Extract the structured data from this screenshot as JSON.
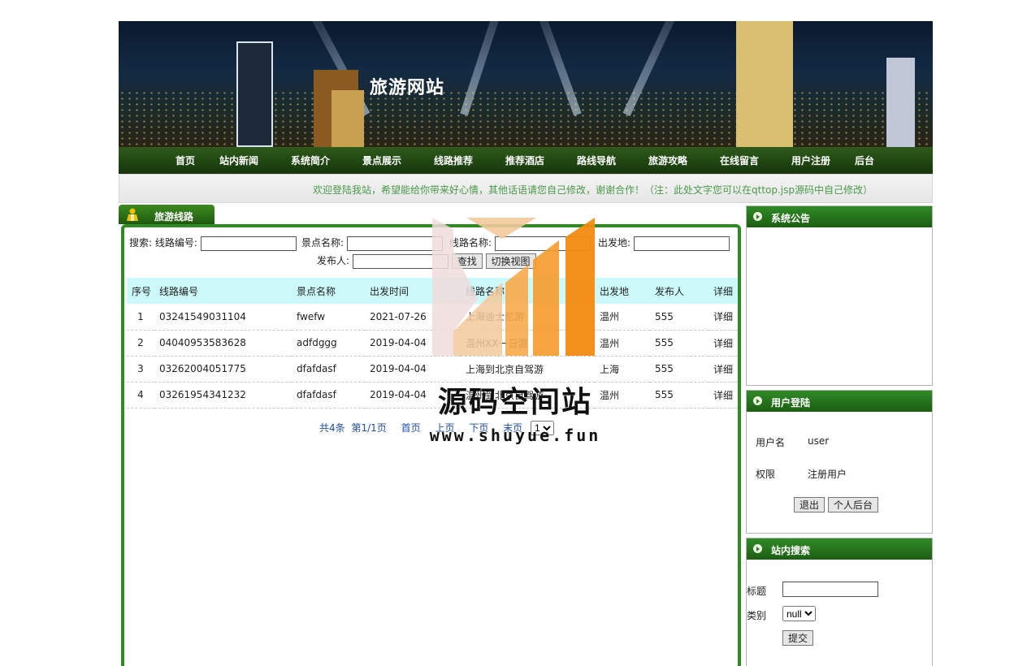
{
  "banner": {
    "title": "旅游网站"
  },
  "nav": {
    "items": [
      "首页",
      "站内新闻",
      "系统简介",
      "景点展示",
      "线路推荐",
      "推荐酒店",
      "路线导航",
      "旅游攻略",
      "在线留言",
      "用户注册",
      "后台"
    ]
  },
  "marquee": {
    "text": "欢迎登陆我站，希望能给你带来好心情，其他话语请您自己修改，谢谢合作！（注：此处文字您可以在qttop.jsp源码中自己修改）"
  },
  "left_panel": {
    "tab_title": "旅游线路",
    "search": {
      "prefix": "搜索:",
      "route_code_label": "线路编号:",
      "spot_name_label": "景点名称:",
      "route_name_label": "线路名称:",
      "departure_label": "出发地:",
      "publisher_label": "发布人:",
      "route_code_value": "",
      "spot_name_value": "",
      "route_name_value": "",
      "departure_value": "",
      "publisher_value": "",
      "search_button": "查找",
      "switch_button": "切换视图"
    },
    "table": {
      "columns": [
        "序号",
        "线路编号",
        "景点名称",
        "出发时间",
        "线路名称",
        "出发地",
        "发布人",
        "详细"
      ],
      "rows": [
        {
          "num": "1",
          "code": "03241549031104",
          "spot": "fwefw",
          "time": "2021-07-26",
          "name": "上海迪士尼游",
          "from": "温州",
          "publisher": "555",
          "detail": "详细"
        },
        {
          "num": "2",
          "code": "04040953583628",
          "spot": "adfdggg",
          "time": "2019-04-04",
          "name": "温州XX一日游",
          "from": "温州",
          "publisher": "555",
          "detail": "详细"
        },
        {
          "num": "3",
          "code": "03262004051775",
          "spot": "dfafdasf",
          "time": "2019-04-04",
          "name": "上海到北京自驾游",
          "from": "上海",
          "publisher": "555",
          "detail": "详细"
        },
        {
          "num": "4",
          "code": "03261954341232",
          "spot": "dfafdasf",
          "time": "2019-04-04",
          "name": "温州到北京自驾游",
          "from": "温州",
          "publisher": "555",
          "detail": "详细"
        }
      ]
    },
    "pager": {
      "total": "共4条",
      "page": "第1/1页",
      "first": "首页",
      "prev": "上页",
      "next": "下页",
      "last": "末页",
      "select_value": "1"
    }
  },
  "watermark": {
    "cn": "源码空间站",
    "en": "www.shuyue.fun"
  },
  "right_panel": {
    "notice": {
      "title": "系统公告"
    },
    "login": {
      "title": "用户登陆",
      "username_label": "用户名",
      "username_value": "user",
      "role_label": "权限",
      "role_value": "注册用户",
      "logout_button": "退出",
      "backend_button": "个人后台"
    },
    "site_search": {
      "title": "站内搜索",
      "title_label": "标题",
      "type_label": "类别",
      "type_value": "null",
      "title_value": "",
      "submit_button": "提交"
    }
  },
  "colors": {
    "nav_green": "#1e4a10",
    "panel_green": "#2f8a26",
    "table_header": "#ccf9f9",
    "link_blue": "#1f4fa8",
    "marquee_text": "#4a9a4a"
  }
}
